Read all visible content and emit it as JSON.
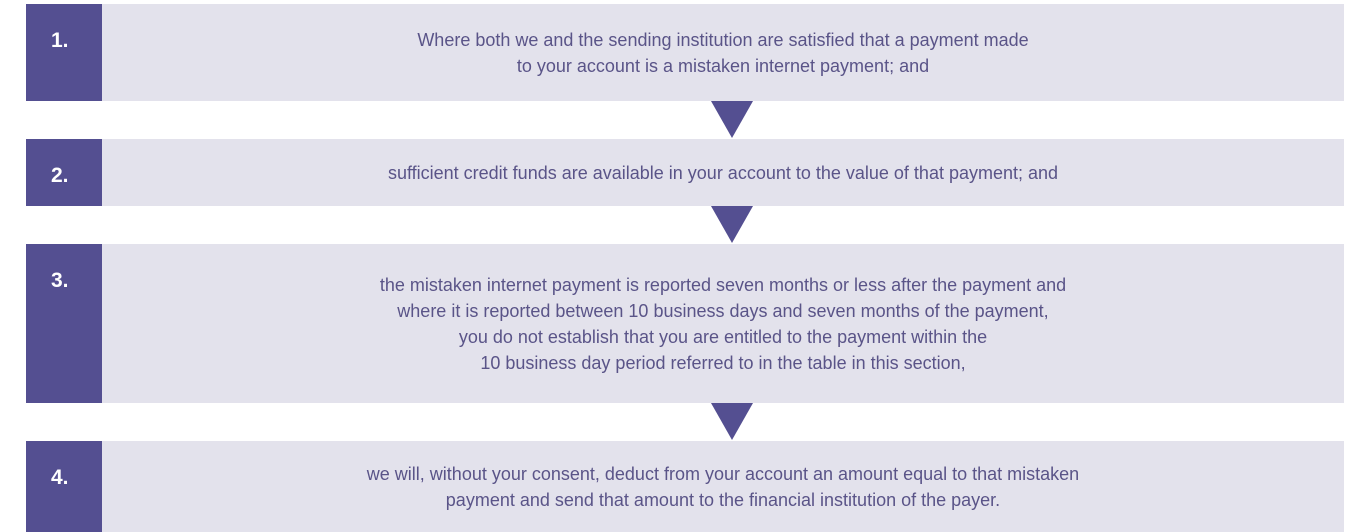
{
  "steps": [
    {
      "number": "1.",
      "text": "Where both we and the sending institution are satisfied that a payment made\nto your account is a mistaken internet payment; and"
    },
    {
      "number": "2.",
      "text": "sufficient credit funds are available in your account to the value of that payment; and"
    },
    {
      "number": "3.",
      "text": "the mistaken internet payment is reported seven months or less after the payment and\nwhere it is reported between 10 business days and seven months of the payment,\nyou do not establish that you are entitled to the payment within the\n10 business day period referred to in the table in this section,"
    },
    {
      "number": "4.",
      "text": "we will, without your consent, deduct from your account an amount equal to that mistaken\npayment and send that amount to the financial institution of the payer."
    }
  ],
  "colors": {
    "accent": "#544f91",
    "box": "#e3e2ec",
    "text": "#5a5488"
  }
}
